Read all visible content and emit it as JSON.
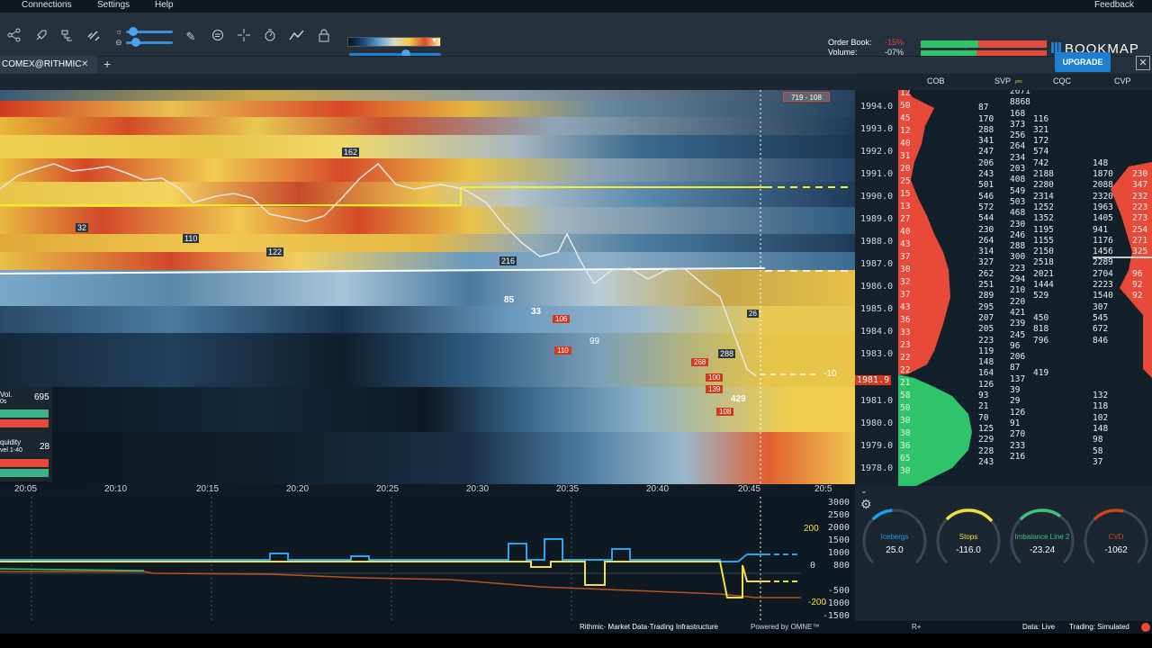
{
  "menubar": {
    "items": [
      "Connections",
      "Settings",
      "Help",
      "Feedback"
    ]
  },
  "toolbar": {
    "icons": [
      "share-icon",
      "rocket-icon",
      "layers-icon",
      "link-icon",
      "pencil-icon",
      "chat-icon",
      "crosshair-icon",
      "timer-icon",
      "chart-line-icon",
      "lock-icon"
    ],
    "order_book_label": "Order Book:",
    "order_book_value": "-15%",
    "volume_label": "Volume:",
    "volume_value": "-07%",
    "logo": "BOOKMAP"
  },
  "tab": {
    "label": "COMEX@RITHMIC",
    "close": "✕",
    "add": "+"
  },
  "upgrade_label": "UPGRADE",
  "panel_close": "✕",
  "columns": {
    "cob": "COB",
    "svp": "SVP",
    "svp_sub": "poc",
    "cqc": "CQC",
    "cvp": "CVP"
  },
  "heatmap": {
    "range_label": "719 - 108"
  },
  "price_ladder": [
    "1994.0",
    "1993.0",
    "1992.0",
    "1991.0",
    "1990.0",
    "1989.0",
    "1988.0",
    "1987.0",
    "1986.0",
    "1985.0",
    "1984.0",
    "1983.0",
    "1981.9",
    "1981.0",
    "1980.0",
    "1979.0",
    "1978.0"
  ],
  "time_axis": [
    "20:05",
    "20:10",
    "20:15",
    "20:20",
    "20:25",
    "20:30",
    "20:35",
    "20:40",
    "20:45",
    "20:5"
  ],
  "cob_sizes": [
    "12",
    "50",
    "45",
    "12",
    "40",
    "31",
    "20",
    "25",
    "15",
    "13",
    "27",
    "40",
    "43",
    "37",
    "30",
    "32",
    "37",
    "43",
    "36",
    "33",
    "23",
    "22",
    "22",
    "21",
    "58",
    "50",
    "30",
    "30",
    "36",
    "65",
    "30"
  ],
  "svp_values": [
    "",
    "87",
    "170",
    "288",
    "341",
    "247",
    "206",
    "243",
    "501",
    "546",
    "572",
    "544",
    "230",
    "264",
    "314",
    "327",
    "262",
    "251",
    "289",
    "295",
    "207",
    "205",
    "223",
    "119",
    "148",
    "164",
    "126",
    "93",
    "21",
    "70",
    "125",
    "229",
    "228",
    "243"
  ],
  "svp_second": [
    "2671",
    "8868",
    "168",
    "373",
    "256",
    "264",
    "234",
    "203",
    "408",
    "549",
    "503",
    "468",
    "230",
    "246",
    "288",
    "300",
    "223",
    "294",
    "210",
    "220",
    "421",
    "239",
    "245",
    "96",
    "206",
    "87",
    "137",
    "39",
    "29",
    "126",
    "91",
    "270",
    "233",
    "216"
  ],
  "cqc_values": [
    "",
    "",
    "116",
    "321",
    "172",
    "574",
    "742",
    "2188",
    "2280",
    "2314",
    "1252",
    "1352",
    "1195",
    "1155",
    "2150",
    "2518",
    "2021",
    "1444",
    "529",
    "",
    "450",
    "818",
    "796",
    "",
    "",
    "419",
    "",
    "",
    "",
    "",
    "",
    "",
    "",
    ""
  ],
  "cvp_values": [
    "",
    "",
    "",
    "",
    "",
    "",
    "148",
    "1870",
    "2088",
    "2320",
    "1963",
    "1405",
    "941",
    "1176",
    "1456",
    "2289",
    "2704",
    "2223",
    "1540",
    "307",
    "545",
    "672",
    "846",
    "",
    "",
    "",
    "",
    "132",
    "118",
    "102",
    "148",
    "98",
    "58",
    "37"
  ],
  "cvp_side": [
    "",
    "",
    "",
    "",
    "",
    "",
    "",
    "230",
    "347",
    "232",
    "223",
    "273",
    "254",
    "271",
    "325",
    "",
    "96",
    "92",
    "92",
    "",
    "",
    "",
    "",
    "",
    "",
    "",
    "",
    "",
    "",
    "",
    "",
    "",
    "",
    ""
  ],
  "trade_markers": [
    "162",
    "32",
    "110",
    "122",
    "216",
    "85",
    "33",
    "106",
    "99",
    "110",
    "288",
    "268",
    "100",
    "139",
    "429",
    "108",
    "26",
    "-10"
  ],
  "vol_widget": {
    "title": "Vol.",
    "value": "695",
    "sub": "0s",
    "liq_title": "quidity",
    "liq_sub": "vel 1-40",
    "liq_value": "28"
  },
  "indicator_axis": [
    "3000",
    "2500",
    "2000",
    "1500",
    "1000",
    "800",
    "0",
    "-500",
    "-1000",
    "-1500"
  ],
  "indicator_markers": [
    "200",
    "-200"
  ],
  "gauges": [
    {
      "name": "Icebergs",
      "value": "25.0",
      "color": "#1e9ef0"
    },
    {
      "name": "Stops",
      "value": "-116.0",
      "color": "#f0e040"
    },
    {
      "name": "Imbalance Line 2",
      "value": "-23.24",
      "color": "#3cc47c"
    },
    {
      "name": "CVD",
      "value": "-1062",
      "color": "#c8461e"
    }
  ],
  "status": {
    "rithmic": "Rithmic· Market Data·Trading Infrastructure",
    "omne": "Powered by OMNE™",
    "r": "R+",
    "data": "Data: Live",
    "trading": "Trading: Simulated"
  }
}
